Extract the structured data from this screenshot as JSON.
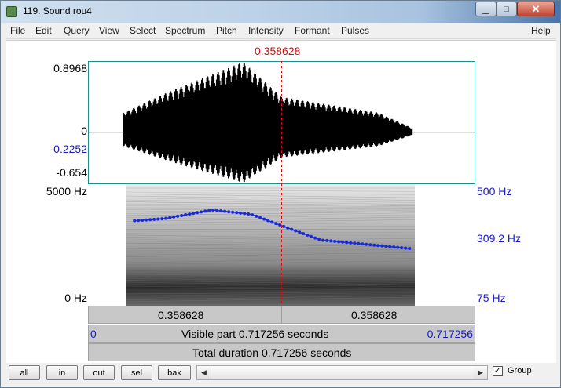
{
  "window": {
    "title": "119. Sound rou4",
    "minimize_glyph": "▁",
    "maximize_glyph": "□",
    "close_glyph": "✕"
  },
  "menu": {
    "items": [
      "File",
      "Edit",
      "Query",
      "View",
      "Select",
      "Spectrum",
      "Pitch",
      "Intensity",
      "Formant",
      "Pulses"
    ],
    "help": "Help"
  },
  "cursor": {
    "time_label": "0.358628",
    "time_fraction": 0.5,
    "color": "#d01010"
  },
  "waveform": {
    "max_label": "0.8968",
    "zero_label": "0",
    "cursor_value_label": "-0.2252",
    "min_label": "-0.654",
    "max": 0.8968,
    "min": -0.654,
    "cursor_value": -0.2252,
    "color": "#000000",
    "frame_color": "#1d8c8c"
  },
  "spectrogram": {
    "top_label": "5000 Hz",
    "bottom_label": "0 Hz",
    "max_hz": 5000,
    "min_hz": 0
  },
  "pitch": {
    "top_label": "500 Hz",
    "cursor_label": "309.2 Hz",
    "bottom_label": "75 Hz",
    "ceiling_hz": 500,
    "floor_hz": 75,
    "cursor_hz": 309.2,
    "color": "#1a2ad8"
  },
  "time_bars": {
    "left_segment": "0.358628",
    "right_segment": "0.358628",
    "visible_start": "0",
    "visible_label": "Visible part 0.717256 seconds",
    "visible_end": "0.717256",
    "total_label": "Total duration 0.717256 seconds"
  },
  "toolbar": {
    "all": "all",
    "in": "in",
    "out": "out",
    "sel": "sel",
    "bak": "bak",
    "scroll_left": "◀",
    "scroll_right": "▶",
    "group_label": "Group",
    "group_checked": true,
    "check_glyph": "✓"
  }
}
